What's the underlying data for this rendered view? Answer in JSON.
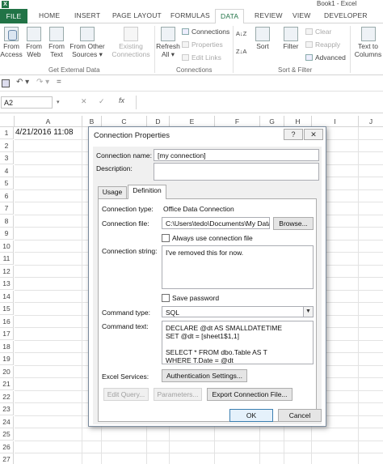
{
  "window": {
    "app_icon": "X",
    "title": "Book1 - Excel"
  },
  "ribbon_tabs": [
    "FILE",
    "HOME",
    "INSERT",
    "PAGE LAYOUT",
    "FORMULAS",
    "DATA",
    "REVIEW",
    "VIEW",
    "DEVELOPER"
  ],
  "ribbon": {
    "get_external": {
      "from_access": [
        "From",
        "Access"
      ],
      "from_web": [
        "From",
        "Web"
      ],
      "from_text": [
        "From",
        "Text"
      ],
      "from_other": [
        "From Other",
        "Sources ▾"
      ],
      "existing": [
        "Existing",
        "Connections"
      ],
      "group_label": "Get External Data"
    },
    "connections": {
      "refresh": [
        "Refresh",
        "All ▾"
      ],
      "connections": "Connections",
      "properties": "Properties",
      "edit_links": "Edit Links",
      "group_label": "Connections"
    },
    "sort_filter": {
      "az": "A↓Z",
      "za": "Z↓A",
      "sort": "Sort",
      "filter": "Filter",
      "clear": "Clear",
      "reapply": "Reapply",
      "advanced": "Advanced",
      "group_label": "Sort & Filter"
    },
    "data_tools": {
      "text_to_columns": [
        "Text to",
        "Columns"
      ]
    }
  },
  "qat": {
    "save_icon": "save-icon",
    "undo": "↶ ▾",
    "redo": "↷ ▾",
    "customize": "="
  },
  "formula_bar": {
    "name_box": "A2",
    "name_dropdown": "▾",
    "cancel": "✕",
    "enter": "✓",
    "fx": "fx",
    "formula": ""
  },
  "sheet": {
    "columns": [
      "A",
      "B",
      "C",
      "D",
      "E",
      "F",
      "G",
      "H",
      "I",
      "J"
    ],
    "rows": [
      "1",
      "2",
      "3",
      "4",
      "5",
      "6",
      "7",
      "8",
      "9",
      "10",
      "11",
      "12",
      "13",
      "14",
      "15",
      "16",
      "17",
      "18",
      "19",
      "20",
      "21",
      "22",
      "23",
      "24",
      "25",
      "26",
      "27"
    ],
    "a1": "4/21/2016 11:08"
  },
  "dialog": {
    "title": "Connection Properties",
    "help": "?",
    "close": "✕",
    "connection_name_label": "Connection name:",
    "connection_name_value": "[my connection]",
    "description_label": "Description:",
    "description_value": "",
    "tabs": [
      "Usage",
      "Definition"
    ],
    "active_tab": "Definition",
    "definition": {
      "connection_type_label": "Connection type:",
      "connection_type_value": "Office Data Connection",
      "connection_file_label": "Connection file:",
      "connection_file_value": "C:\\Users\\tedo\\Documents\\My Data S",
      "browse": "Browse...",
      "always_use_label": "Always use connection file",
      "connection_string_label": "Connection string:",
      "connection_string_value": "I've removed this for now.",
      "save_password_label": "Save password",
      "command_type_label": "Command type:",
      "command_type_value": "SQL",
      "command_text_label": "Command text:",
      "command_text_value": "DECLARE @dt AS SMALLDATETIME\nSET @dt = [sheet1$1,1]\n\nSELECT * FROM dbo.Table AS T\nWHERE T.Date = @dt",
      "excel_services_label": "Excel Services:",
      "auth_settings": "Authentication Settings...",
      "edit_query": "Edit Query...",
      "parameters": "Parameters...",
      "export_file": "Export Connection File..."
    },
    "ok": "OK",
    "cancel": "Cancel"
  }
}
